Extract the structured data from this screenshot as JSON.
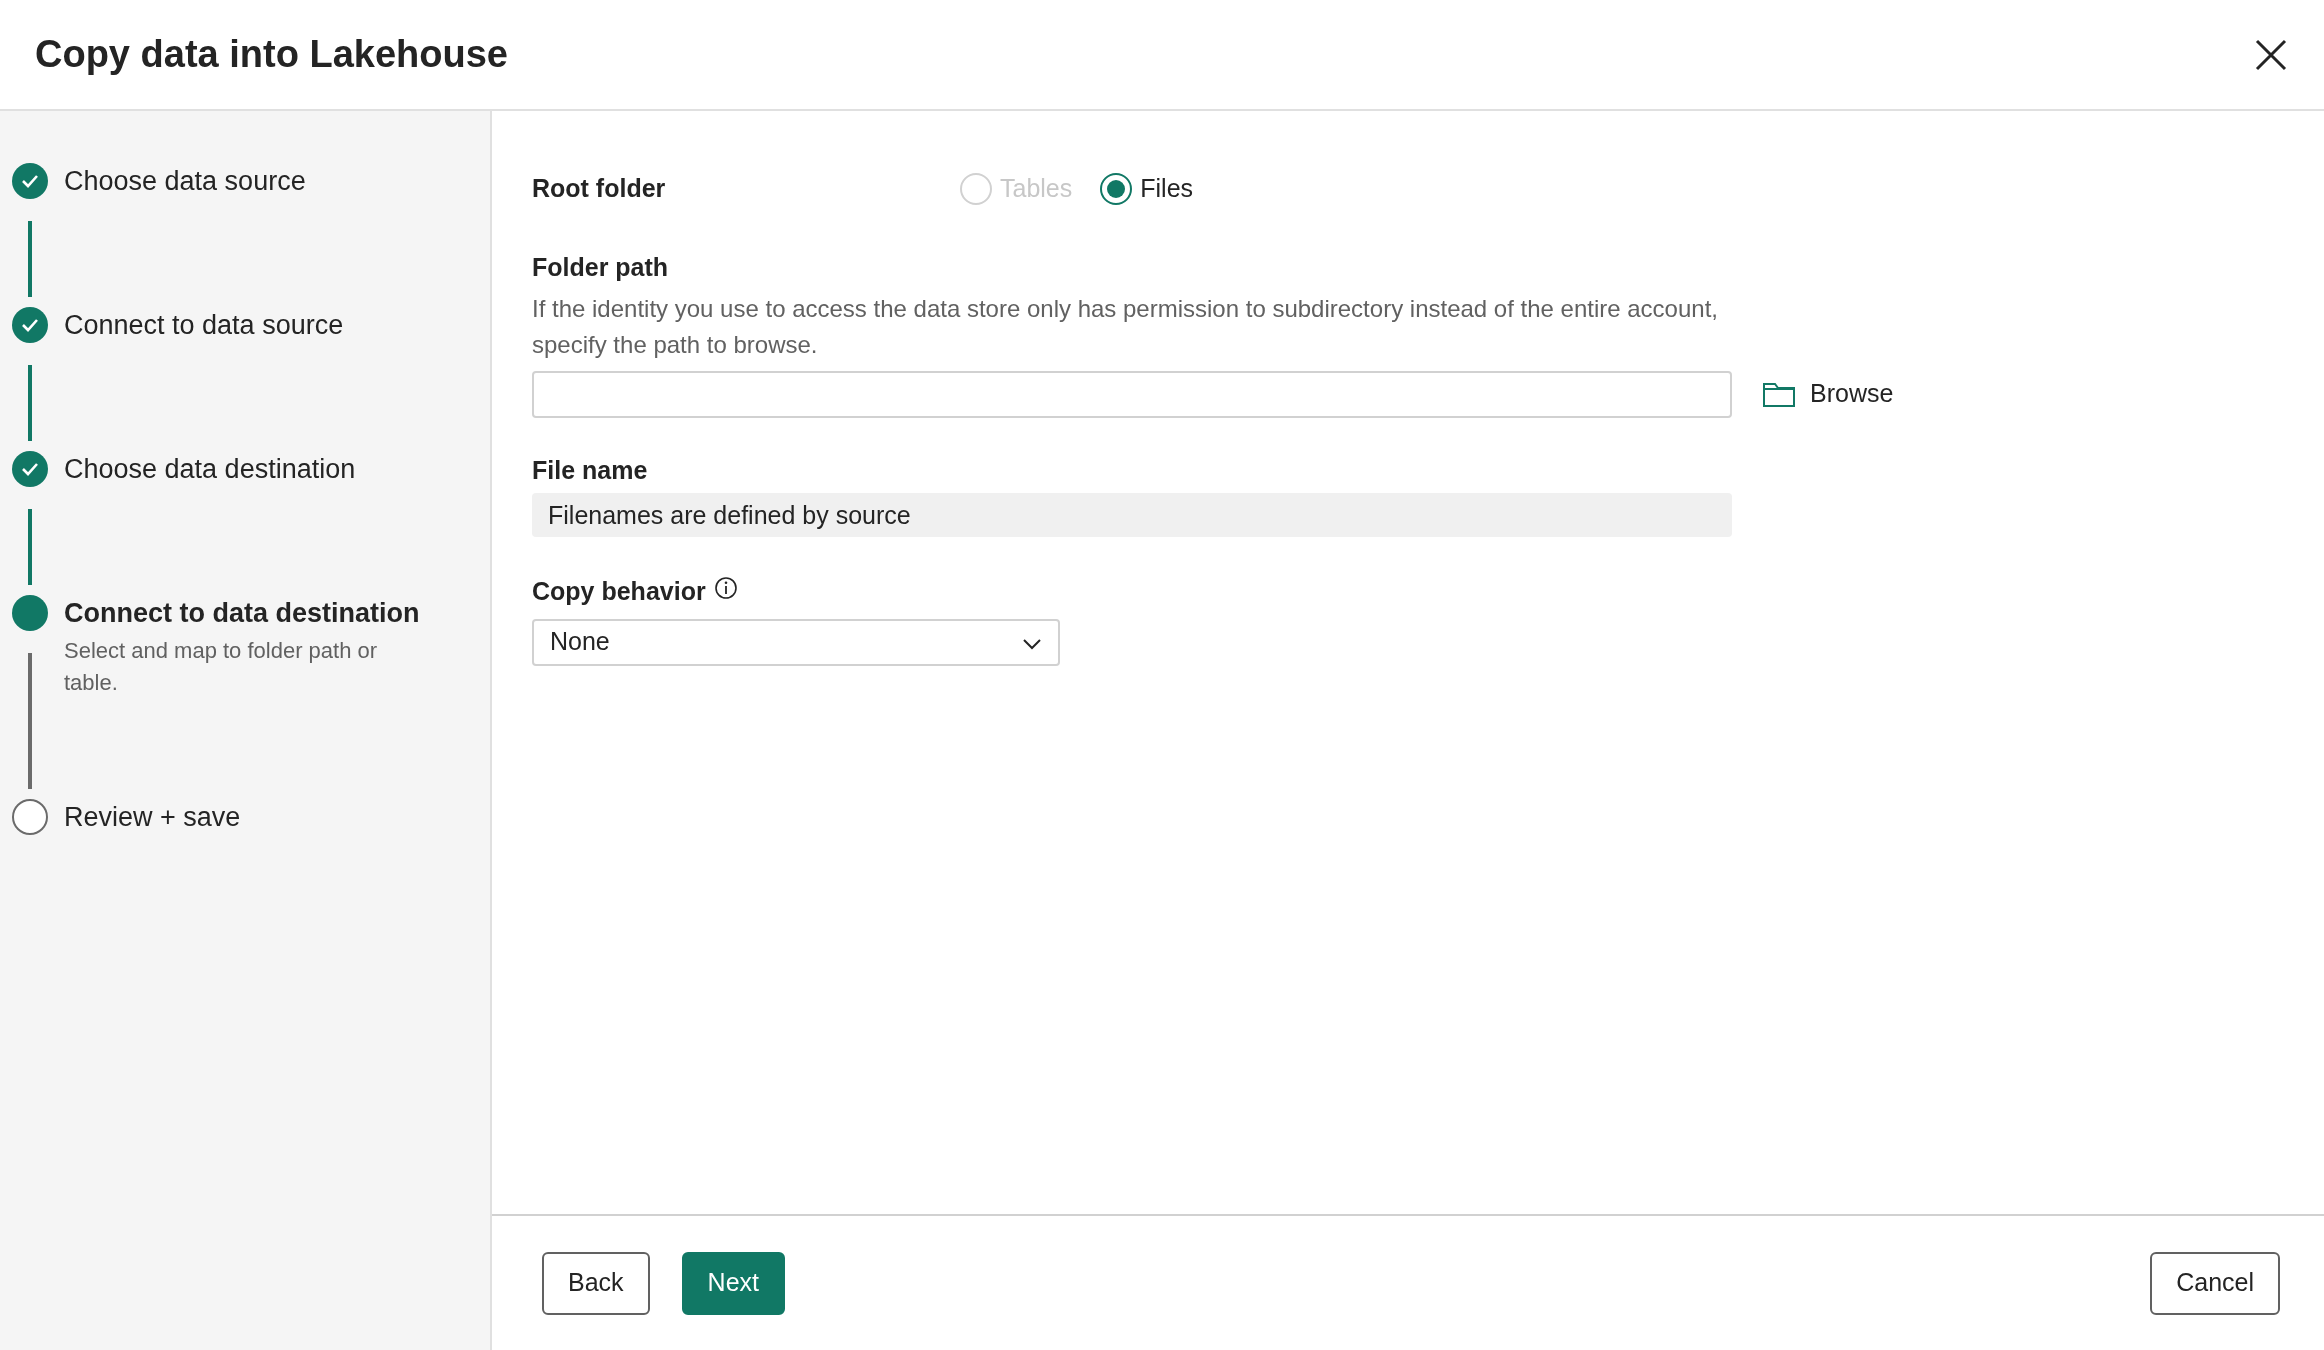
{
  "dialog": {
    "title": "Copy data into Lakehouse"
  },
  "steps": [
    {
      "label": "Choose data source",
      "kind": "done"
    },
    {
      "label": "Connect to data source",
      "kind": "done"
    },
    {
      "label": "Choose data destination",
      "kind": "done"
    },
    {
      "label": "Connect to data destination",
      "kind": "current",
      "description": "Select and map to folder path or table."
    },
    {
      "label": "Review + save",
      "kind": "pending"
    }
  ],
  "form": {
    "root_folder": {
      "label": "Root folder",
      "options": [
        {
          "label": "Tables",
          "selected": false,
          "disabled": true
        },
        {
          "label": "Files",
          "selected": true,
          "disabled": false
        }
      ]
    },
    "folder_path": {
      "label": "Folder path",
      "description": "If the identity you use to access the data store only has permission to subdirectory instead of the entire account, specify the path to browse.",
      "browse": "Browse"
    },
    "file_name": {
      "label": "File name",
      "value": "Filenames are defined by source"
    },
    "copy_behavior": {
      "label": "Copy behavior",
      "value": "None"
    }
  },
  "footer": {
    "buttons": [
      {
        "label": "Back",
        "kind": "secondary"
      },
      {
        "label": "Next",
        "kind": "primary"
      },
      {
        "label": "Cancel",
        "kind": "secondary"
      }
    ]
  }
}
